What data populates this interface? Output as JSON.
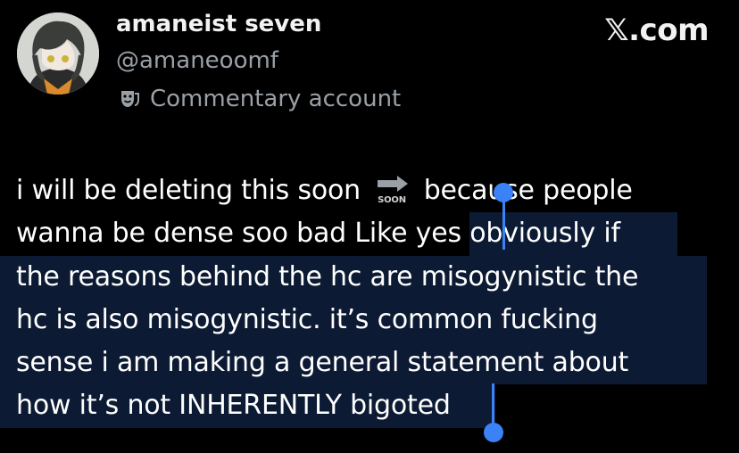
{
  "header": {
    "display_name": "amaneist seven",
    "handle": "@amaneoomf",
    "badge_label": "Commentary account",
    "badge_icon": "theater-masks-icon",
    "brand": "𝕏.com"
  },
  "tweet": {
    "line1_before": "i will be deleting this soon",
    "line1_emoji": "soon-arrow-icon",
    "line1_after": "because people",
    "line2_unselected": "wanna be dense soo bad Like yes ",
    "line2_selected": "obviously if",
    "line3": "the reasons behind the hc are misogynistic the",
    "line4": "hc is also misogynistic. it’s common fucking",
    "line5": "sense i am making a general statement about",
    "line6": "how it’s not INHERENTLY bigoted"
  },
  "colors": {
    "background": "#000000",
    "selection": "#0c1a33",
    "selection_handle": "#3b82f6"
  }
}
